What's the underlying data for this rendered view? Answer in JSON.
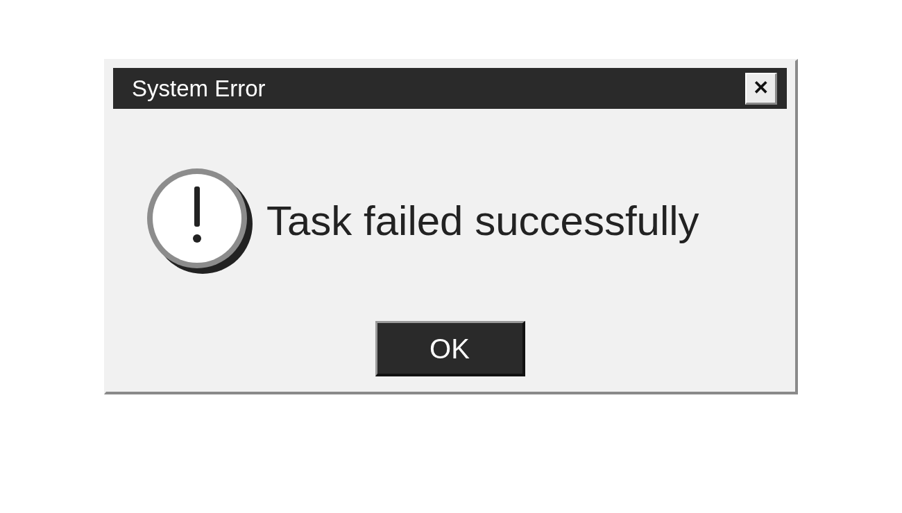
{
  "window": {
    "title": "System Error",
    "close_label": "✕"
  },
  "message": {
    "text": "Task failed successfully"
  },
  "buttons": [
    "OK"
  ]
}
